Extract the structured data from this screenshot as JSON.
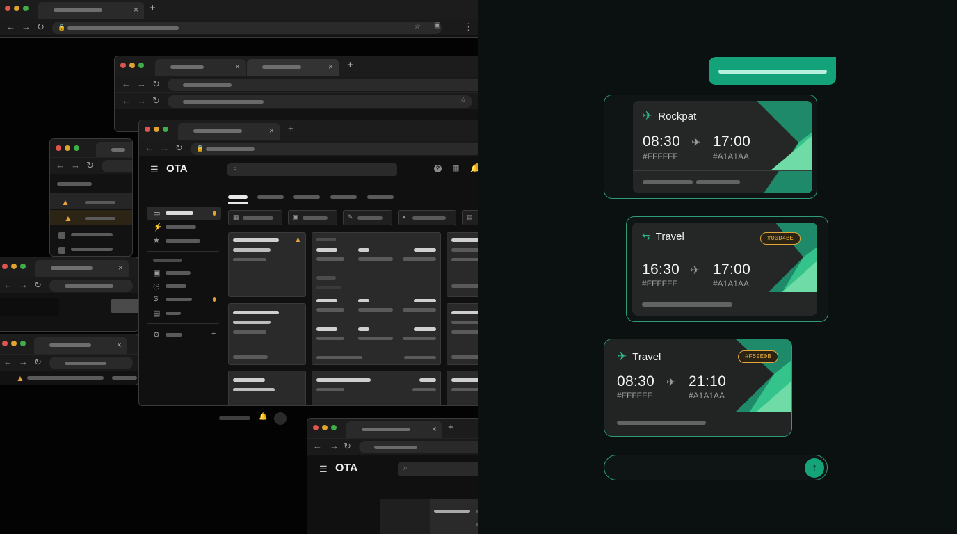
{
  "app_name": "OTA",
  "accent_color": "#14A27A",
  "warning_color": "#E9A23B",
  "icons": {
    "menu": "hamburger-icon",
    "search": "search-icon",
    "help": "help-icon",
    "apps": "apps-grid-icon",
    "notifications": "bell-icon",
    "plane": "plane-icon",
    "send": "arrow-up-icon"
  },
  "chat": {
    "flights": [
      {
        "airline": "Rockpat",
        "depart": "08:30",
        "arrive": "17:00",
        "depart_code": "#FFFFFF",
        "arrive_code": "#A1A1AA",
        "badge": ""
      },
      {
        "airline": "Travel",
        "depart": "16:30",
        "arrive": "17:00",
        "depart_code": "#FFFFFF",
        "arrive_code": "#A1A1AA",
        "badge": "#00D4BE"
      },
      {
        "airline": "Travel",
        "depart": "08:30",
        "arrive": "21:10",
        "depart_code": "#FFFFFF",
        "arrive_code": "#A1A1AA",
        "badge": "#F59E0B"
      }
    ],
    "input_placeholder": ""
  }
}
